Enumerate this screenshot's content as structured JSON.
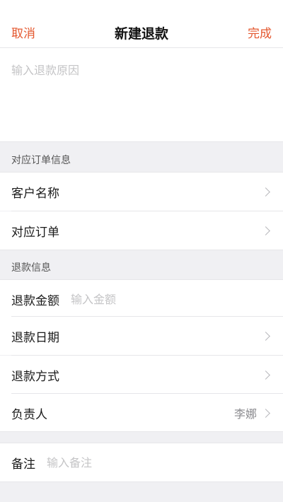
{
  "nav": {
    "cancel": "取消",
    "title": "新建退款",
    "done": "完成"
  },
  "reason": {
    "placeholder": "输入退款原因"
  },
  "order_section": {
    "header": "对应订单信息",
    "customer_label": "客户名称",
    "order_label": "对应订单"
  },
  "refund_section": {
    "header": "退款信息",
    "amount_label": "退款金额",
    "amount_placeholder": "输入金额",
    "date_label": "退款日期",
    "method_label": "退款方式",
    "owner_label": "负责人",
    "owner_value": "李娜"
  },
  "remark": {
    "label": "备注",
    "placeholder": "输入备注"
  },
  "colors": {
    "accent": "#e4572e",
    "background": "#f0f0f3",
    "placeholder": "#c4c4c6"
  }
}
